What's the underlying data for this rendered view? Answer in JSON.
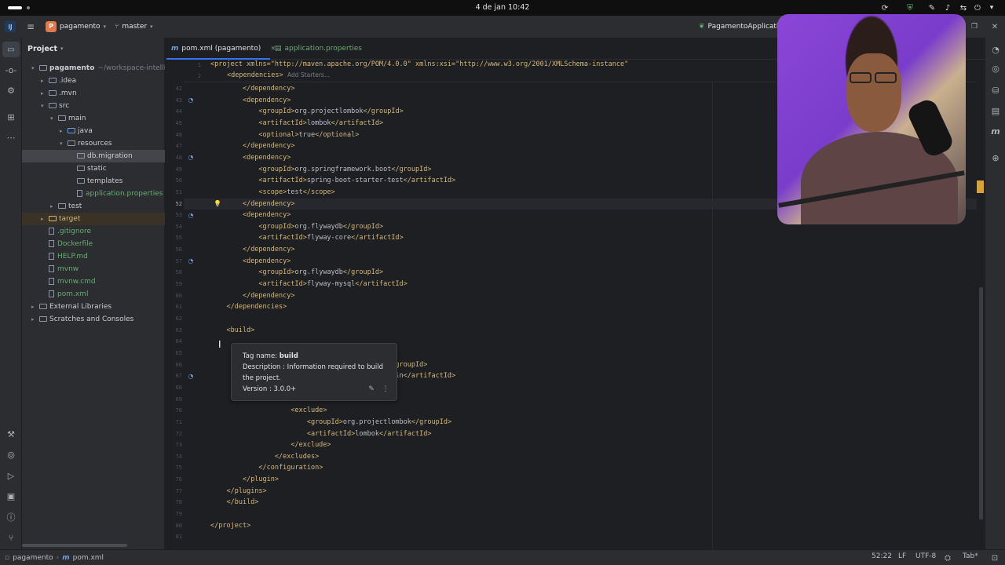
{
  "os": {
    "clock": "4 de jan 10:42"
  },
  "titlebar": {
    "project_badge": "P",
    "project": "pagamento",
    "branch": "master",
    "run_config": "PagamentoApplicati"
  },
  "project_panel": {
    "title": "Project"
  },
  "tree": [
    {
      "label": "pagamento",
      "suffix": "~/workspace-intellij-ide",
      "depth": 0,
      "kind": "folder",
      "open": true,
      "bold": true,
      "color": "#c9ccd1"
    },
    {
      "label": ".idea",
      "depth": 1,
      "kind": "folder",
      "open": false,
      "color": "#c9ccd1"
    },
    {
      "label": ".mvn",
      "depth": 1,
      "kind": "folder",
      "open": false,
      "color": "#c9ccd1"
    },
    {
      "label": "src",
      "depth": 1,
      "kind": "folder",
      "open": true,
      "color": "#c9ccd1"
    },
    {
      "label": "main",
      "depth": 2,
      "kind": "folder",
      "open": true,
      "color": "#c9ccd1"
    },
    {
      "label": "java",
      "depth": 3,
      "kind": "folder",
      "open": false,
      "color": "#c9ccd1"
    },
    {
      "label": "resources",
      "depth": 3,
      "kind": "folder",
      "open": true,
      "color": "#c9ccd1"
    },
    {
      "label": "db.migration",
      "depth": 4,
      "kind": "folder",
      "color": "#c9ccd1",
      "selected": true
    },
    {
      "label": "static",
      "depth": 4,
      "kind": "folder",
      "color": "#c9ccd1"
    },
    {
      "label": "templates",
      "depth": 4,
      "kind": "folder",
      "color": "#c9ccd1"
    },
    {
      "label": "application.properties",
      "depth": 4,
      "kind": "file",
      "color": "#6aab73"
    },
    {
      "label": "test",
      "depth": 2,
      "kind": "folder",
      "open": false,
      "color": "#c9ccd1"
    },
    {
      "label": "target",
      "depth": 1,
      "kind": "folder",
      "open": false,
      "color": "#d5b778",
      "excluded": true
    },
    {
      "label": ".gitignore",
      "depth": 1,
      "kind": "file",
      "color": "#6aab73"
    },
    {
      "label": "Dockerfile",
      "depth": 1,
      "kind": "file",
      "color": "#6aab73"
    },
    {
      "label": "HELP.md",
      "depth": 1,
      "kind": "file",
      "color": "#6aab73"
    },
    {
      "label": "mvnw",
      "depth": 1,
      "kind": "file",
      "color": "#6aab73"
    },
    {
      "label": "mvnw.cmd",
      "depth": 1,
      "kind": "file",
      "color": "#6aab73"
    },
    {
      "label": "pom.xml",
      "depth": 1,
      "kind": "file",
      "color": "#6aab73"
    },
    {
      "label": "External Libraries",
      "depth": 0,
      "kind": "lib",
      "open": false,
      "color": "#c9ccd1"
    },
    {
      "label": "Scratches and Consoles",
      "depth": 0,
      "kind": "scratch",
      "open": false,
      "color": "#c9ccd1"
    }
  ],
  "tabs": [
    {
      "label": "pom.xml (pagamento)",
      "active": true,
      "closable": true
    },
    {
      "label": "application.properties",
      "active": false,
      "closable": false
    }
  ],
  "sticky": {
    "line1": "<project xmlns=\"http://maven.apache.org/POM/4.0.0\" xmlns:xsi=\"http://www.w3.org/2001/XMLSchema-instance\"",
    "line2_tag": "<dependencies>",
    "line2_hint": "Add Starters..."
  },
  "code_lines": [
    {
      "n": "42",
      "text": "        </dependency>"
    },
    {
      "n": "43",
      "text": "        <dependency>",
      "mark": true
    },
    {
      "n": "44",
      "text": "            <groupId>org.projectlombok</groupId>"
    },
    {
      "n": "45",
      "text": "            <artifactId>lombok</artifactId>"
    },
    {
      "n": "46",
      "text": "            <optional>true</optional>"
    },
    {
      "n": "47",
      "text": "        </dependency>"
    },
    {
      "n": "48",
      "text": "        <dependency>",
      "mark": true
    },
    {
      "n": "49",
      "text": "            <groupId>org.springframework.boot</groupId>"
    },
    {
      "n": "50",
      "text": "            <artifactId>spring-boot-starter-test</artifactId>"
    },
    {
      "n": "51",
      "text": "            <scope>test</scope>"
    },
    {
      "n": "52",
      "text": "        </dependency>",
      "current": true,
      "bulb": true
    },
    {
      "n": "53",
      "text": "        <dependency>",
      "mark": true
    },
    {
      "n": "54",
      "text": "            <groupId>org.flywaydb</groupId>"
    },
    {
      "n": "55",
      "text": "            <artifactId>flyway-core</artifactId>"
    },
    {
      "n": "56",
      "text": "        </dependency>"
    },
    {
      "n": "57",
      "text": "        <dependency>",
      "mark": true
    },
    {
      "n": "58",
      "text": "            <groupId>org.flywaydb</groupId>"
    },
    {
      "n": "59",
      "text": "            <artifactId>flyway-mysql</artifactId>"
    },
    {
      "n": "60",
      "text": "        </dependency>"
    },
    {
      "n": "61",
      "text": "    </dependencies>"
    },
    {
      "n": "62",
      "text": ""
    },
    {
      "n": "63",
      "text": "    <build>"
    },
    {
      "n": "64",
      "text": ""
    },
    {
      "n": "65",
      "text": ""
    },
    {
      "n": "66",
      "text": "                                        boot</groupId>"
    },
    {
      "n": "67",
      "text": "                                        n-plugin</artifactId>",
      "mark": true
    },
    {
      "n": "68",
      "text": ""
    },
    {
      "n": "69",
      "text": "                <excludes>"
    },
    {
      "n": "70",
      "text": "                    <exclude>"
    },
    {
      "n": "71",
      "text": "                        <groupId>org.projectlombok</groupId>"
    },
    {
      "n": "72",
      "text": "                        <artifactId>lombok</artifactId>"
    },
    {
      "n": "73",
      "text": "                    </exclude>"
    },
    {
      "n": "74",
      "text": "                </excludes>"
    },
    {
      "n": "75",
      "text": "            </configuration>"
    },
    {
      "n": "76",
      "text": "        </plugin>"
    },
    {
      "n": "77",
      "text": "    </plugins>"
    },
    {
      "n": "78",
      "text": "    </build>"
    },
    {
      "n": "79",
      "text": ""
    },
    {
      "n": "80",
      "text": "</project>"
    },
    {
      "n": "81",
      "text": ""
    }
  ],
  "tooltip": {
    "tag_label": "Tag name:",
    "tag_value": "build",
    "description_line1": "Description : Information required to build",
    "description_line2": "the project.",
    "version": "Version : 3.0.0+"
  },
  "statusbar": {
    "crumb_project": "pagamento",
    "crumb_file": "pom.xml",
    "position": "52:22",
    "line_sep": "LF",
    "encoding": "UTF-8",
    "indent": "Tab*"
  },
  "colors": {
    "tag": "#d5b778",
    "attr": "#bababa",
    "value": "#6aab73",
    "bg": "#1e1f22",
    "panel": "#2b2d30",
    "webcam_bg": "#8b46d8"
  }
}
